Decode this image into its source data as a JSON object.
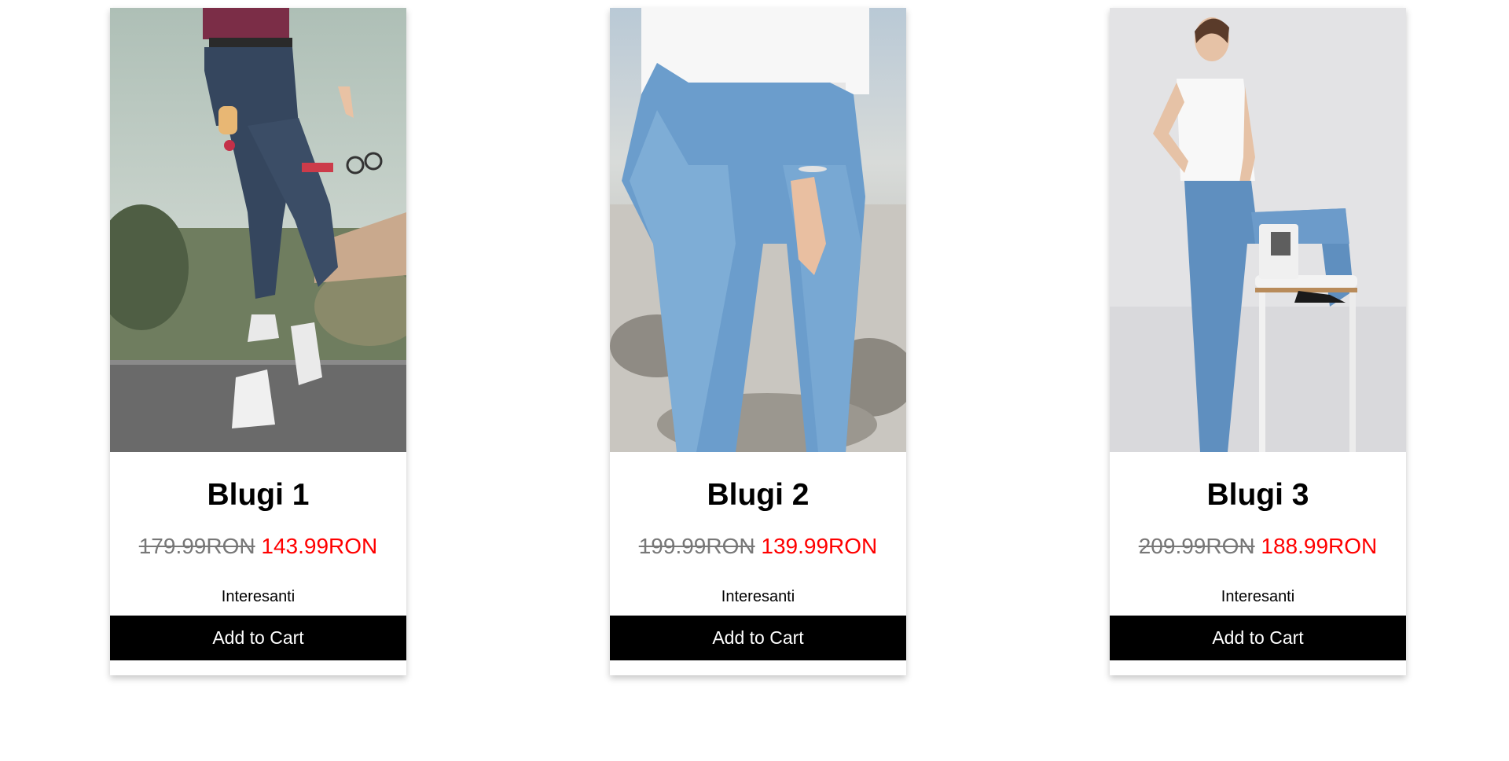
{
  "products": [
    {
      "title": "Blugi 1",
      "old_price": "179.99RON",
      "new_price": "143.99RON",
      "description": "Interesanti",
      "button_label": "Add to Cart"
    },
    {
      "title": "Blugi 2",
      "old_price": "199.99RON",
      "new_price": "139.99RON",
      "description": "Interesanti",
      "button_label": "Add to Cart"
    },
    {
      "title": "Blugi 3",
      "old_price": "209.99RON",
      "new_price": "188.99RON",
      "description": "Interesanti",
      "button_label": "Add to Cart"
    }
  ],
  "colors": {
    "old_price": "#777777",
    "new_price": "#ff0000",
    "button_bg": "#000000",
    "button_text": "#ffffff"
  }
}
